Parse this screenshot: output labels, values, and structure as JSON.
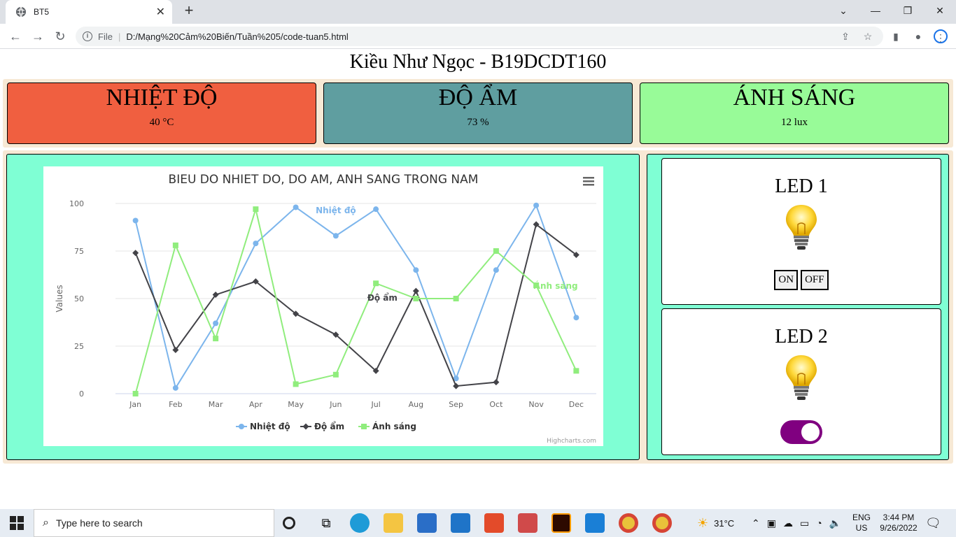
{
  "browser": {
    "tab_title": "BT5",
    "tab_close": "✕",
    "new_tab": "+",
    "address_file_label": "File",
    "address_url": "D:/Mạng%20Cảm%20Biến/Tuần%205/code-tuan5.html"
  },
  "page": {
    "title": "Kiều Như Ngọc - B19DCDT160"
  },
  "sensors": [
    {
      "title": "NHIỆT ĐỘ",
      "value": "40 °C",
      "color": "#f05f40"
    },
    {
      "title": "ĐỘ ẨM",
      "value": "73 %",
      "color": "#5f9ea0"
    },
    {
      "title": "ÁNH SÁNG",
      "value": "12 lux",
      "color": "#98fb98"
    }
  ],
  "chart_data": {
    "type": "line",
    "title": "BIEU DO NHIET DO, DO AM, ANH SANG TRONG NAM",
    "ylabel": "Values",
    "xlabel": "",
    "categories": [
      "Jan",
      "Feb",
      "Mar",
      "Apr",
      "May",
      "Jun",
      "Jul",
      "Aug",
      "Sep",
      "Oct",
      "Nov",
      "Dec"
    ],
    "ylim": [
      0,
      100
    ],
    "yticks": [
      "0",
      "25",
      "50",
      "75",
      "100"
    ],
    "grid": true,
    "legend": "bottom-center",
    "series": [
      {
        "name": "Nhiệt độ",
        "color": "#7cb5ec",
        "marker": "circle",
        "values": [
          91,
          3,
          37,
          79,
          98,
          83,
          97,
          65,
          8,
          65,
          99,
          40
        ]
      },
      {
        "name": "Độ ẩm",
        "color": "#434348",
        "marker": "diamond",
        "values": [
          74,
          23,
          52,
          59,
          42,
          31,
          12,
          54,
          4,
          6,
          89,
          73
        ]
      },
      {
        "name": "Ánh sáng",
        "color": "#90ed7d",
        "marker": "square",
        "values": [
          0,
          78,
          29,
          97,
          5,
          10,
          58,
          50,
          50,
          75,
          57,
          12
        ]
      }
    ],
    "credits": "Highcharts.com"
  },
  "leds": [
    {
      "title": "LED 1",
      "on_label": "ON",
      "off_label": "OFF"
    },
    {
      "title": "LED 2",
      "state": "on"
    }
  ],
  "taskbar": {
    "search_placeholder": "Type here to search",
    "weather": "31°C",
    "lang_line1": "ENG",
    "lang_line2": "US",
    "time": "3:44 PM",
    "date": "9/26/2022"
  }
}
